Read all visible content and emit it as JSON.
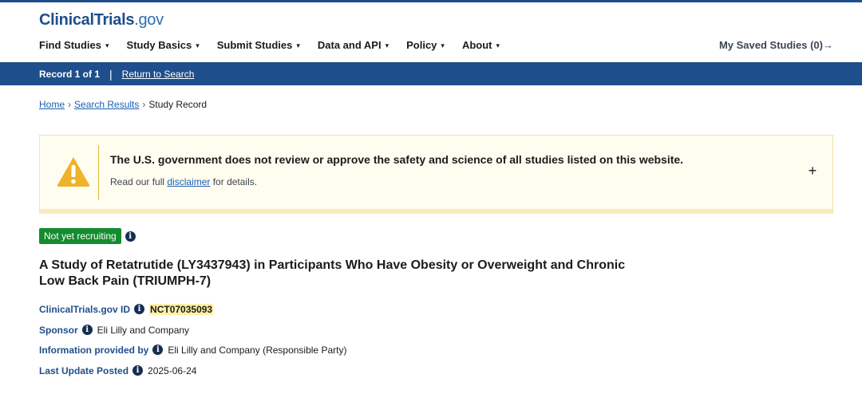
{
  "header": {
    "logo_main": "ClinicalTrials",
    "logo_suffix": ".gov",
    "nav": [
      {
        "label": "Find Studies"
      },
      {
        "label": "Study Basics"
      },
      {
        "label": "Submit Studies"
      },
      {
        "label": "Data and API"
      },
      {
        "label": "Policy"
      },
      {
        "label": "About"
      }
    ],
    "saved_label": "My Saved Studies (0)→"
  },
  "record_bar": {
    "record_label": "Record 1 of 1",
    "separator": "|",
    "return_label": "Return to Search"
  },
  "breadcrumb": {
    "home": "Home",
    "search_results": "Search Results",
    "current": "Study Record",
    "arrow": "›"
  },
  "alert": {
    "message": "The U.S. government does not review or approve the safety and science of all studies listed on this website.",
    "sub_prefix": "Read our full ",
    "sub_link": "disclaimer",
    "sub_suffix": " for details.",
    "expand_symbol": "+",
    "icon_color": "#f0b22b"
  },
  "study": {
    "status": "Not yet recruiting",
    "status_color": "#138c2e",
    "title": "A Study of Retatrutide (LY3437943) in Participants Who Have Obesity or Overweight and Chronic Low Back Pain (TRIUMPH-7)",
    "id_label": "ClinicalTrials.gov ID",
    "id_value": "NCT07035093",
    "sponsor_label": "Sponsor",
    "sponsor_value": "Eli Lilly and Company",
    "info_label": "Information provided by",
    "info_value": "Eli Lilly and Company (Responsible Party)",
    "update_label": "Last Update Posted",
    "update_value": "2025-06-24"
  }
}
